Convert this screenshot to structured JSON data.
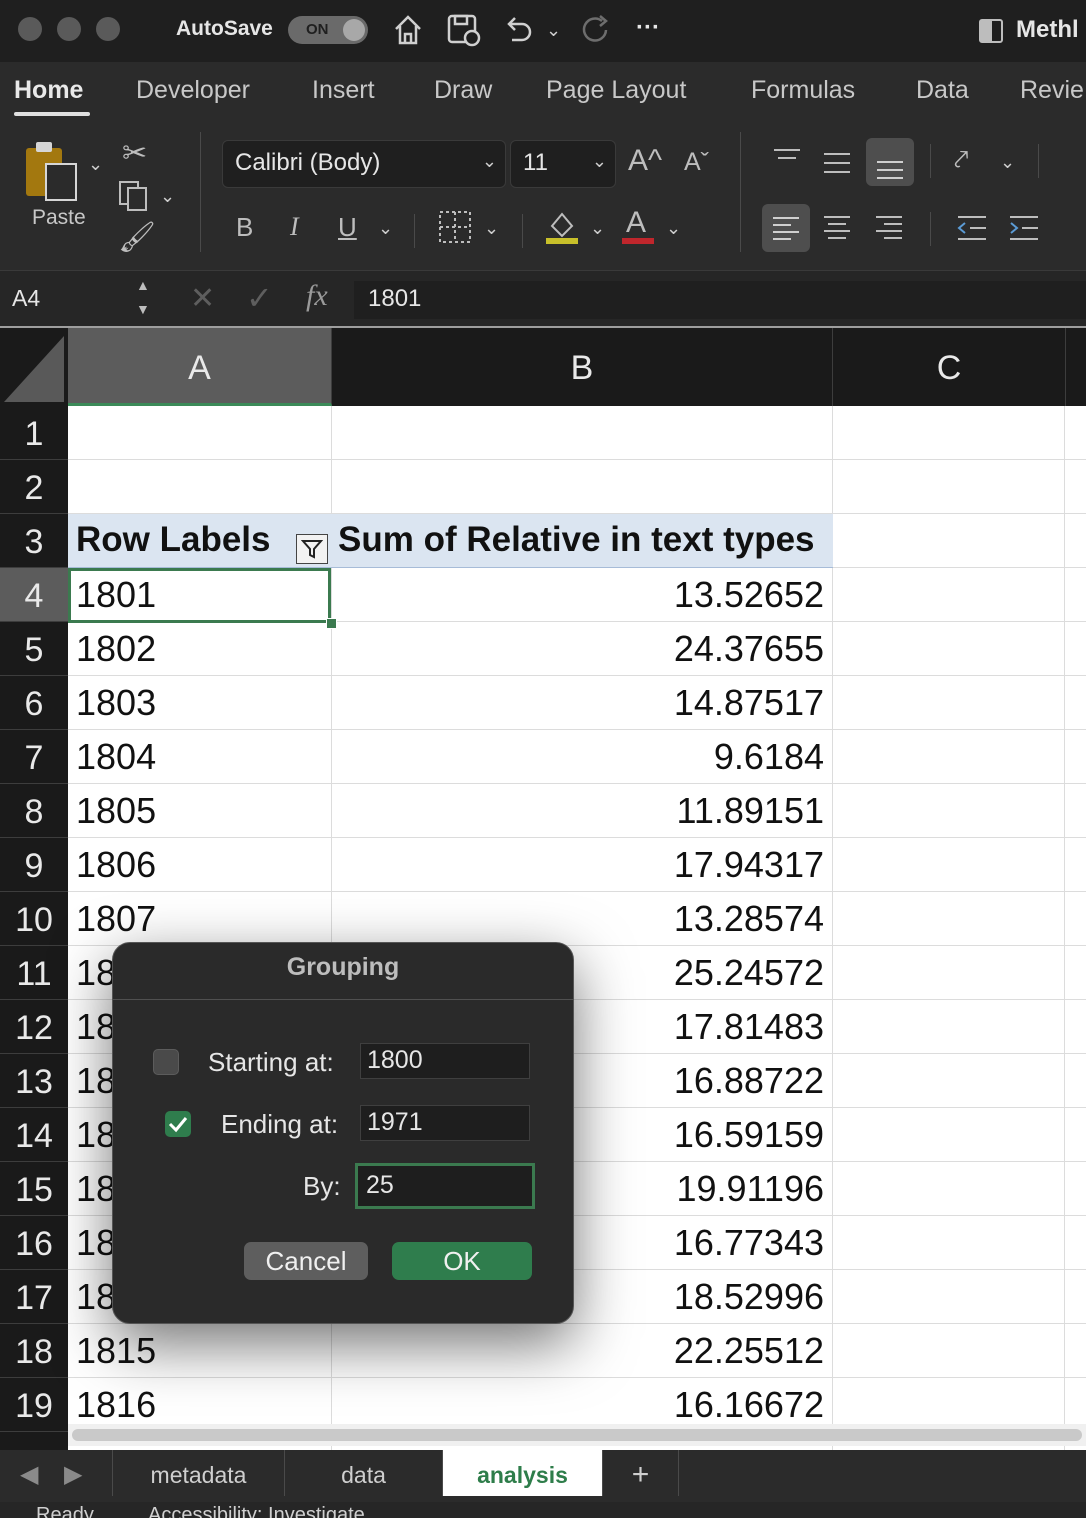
{
  "titlebar": {
    "autosave_label": "AutoSave",
    "autosave_state": "ON",
    "doc_title": "Methl",
    "icons": [
      "home-icon",
      "save-icon",
      "undo-icon",
      "redo-icon",
      "more-icon"
    ]
  },
  "ribbon": {
    "tabs": [
      "Home",
      "Developer",
      "Insert",
      "Draw",
      "Page Layout",
      "Formulas",
      "Data",
      "Revie"
    ],
    "active_tab": "Home",
    "paste_label": "Paste",
    "font_name": "Calibri (Body)",
    "font_size": "11",
    "grow_font": "A^",
    "shrink_font": "Aˇ",
    "bold": "B",
    "italic": "I",
    "underline": "U",
    "font_color_letter": "A",
    "colors": {
      "highlight": "#c8c02a",
      "font_color": "#c0262c",
      "accent": "#3b7a4f"
    }
  },
  "formula_bar": {
    "name_box": "A4",
    "fx_label": "fx",
    "formula": "1801"
  },
  "sheet": {
    "columns": [
      "A",
      "B",
      "C"
    ],
    "row_numbers": [
      "1",
      "2",
      "3",
      "4",
      "5",
      "6",
      "7",
      "8",
      "9",
      "10",
      "11",
      "12",
      "13",
      "14",
      "15",
      "16",
      "17",
      "18",
      "19"
    ],
    "header_row": {
      "a": "Row Labels",
      "b": "Sum of Relative in text types"
    },
    "rows": [
      {
        "a": "1801",
        "b": "13.52652"
      },
      {
        "a": "1802",
        "b": "24.37655"
      },
      {
        "a": "1803",
        "b": "14.87517"
      },
      {
        "a": "1804",
        "b": "9.6184"
      },
      {
        "a": "1805",
        "b": "11.89151"
      },
      {
        "a": "1806",
        "b": "17.94317"
      },
      {
        "a": "1807",
        "b": "13.28574"
      },
      {
        "a": "18",
        "b": "25.24572"
      },
      {
        "a": "18",
        "b": "17.81483"
      },
      {
        "a": "18",
        "b": "16.88722"
      },
      {
        "a": "18",
        "b": "16.59159"
      },
      {
        "a": "18",
        "b": "19.91196"
      },
      {
        "a": "18",
        "b": "16.77343"
      },
      {
        "a": "18",
        "b": "18.52996"
      },
      {
        "a": "1815",
        "b": "22.25512"
      },
      {
        "a": "1816",
        "b": "16.16672"
      }
    ],
    "selected_cell": "A4"
  },
  "sheet_tabs": {
    "tabs": [
      "metadata",
      "data",
      "analysis"
    ],
    "active": "analysis",
    "add_label": "+"
  },
  "status_bar": {
    "ready": "Ready",
    "accessibility": "Accessibility: Investigate"
  },
  "dialog": {
    "title": "Grouping",
    "starting_label": "Starting at:",
    "starting_value": "1800",
    "starting_checked": false,
    "ending_label": "Ending at:",
    "ending_value": "1971",
    "ending_checked": true,
    "by_label": "By:",
    "by_value": "25",
    "cancel_label": "Cancel",
    "ok_label": "OK"
  }
}
